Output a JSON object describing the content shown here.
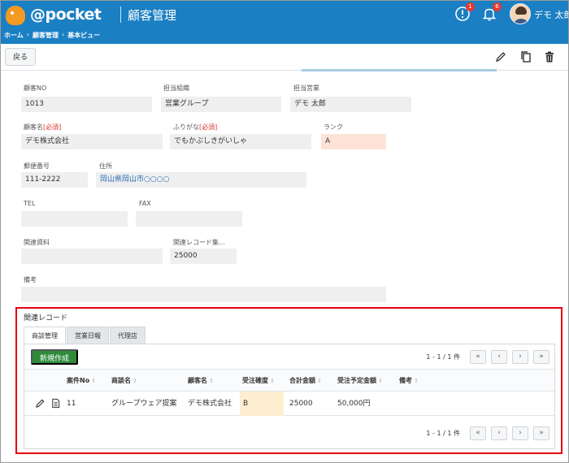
{
  "header": {
    "brand": "@pocket",
    "page_title": "顧客管理",
    "breadcrumb": [
      "ホーム",
      "顧客管理",
      "基本ビュー"
    ],
    "alerts_count": "1",
    "notifications_count": "6",
    "user_name": "デモ 太郎"
  },
  "toolbar": {
    "back_label": "戻る",
    "icons": [
      "edit-icon",
      "copy-icon",
      "trash-icon"
    ]
  },
  "form": {
    "customer_no": {
      "label": "顧客NO",
      "value": "1013"
    },
    "department": {
      "label": "担当組織",
      "value": "営業グループ"
    },
    "sales_rep": {
      "label": "担当営業",
      "value": "デモ 太郎"
    },
    "customer_name": {
      "label": "顧客名",
      "required": "[必須]",
      "value": "デモ株式会社"
    },
    "furigana": {
      "label": "ふりがな",
      "required": "[必須]",
      "value": "でもかぶしきがいしゃ"
    },
    "rank": {
      "label": "ランク",
      "value": "A"
    },
    "postal_code": {
      "label": "郵便番号",
      "value": "111-2222"
    },
    "address": {
      "label": "住所",
      "value": "岡山県岡山市○○○○"
    },
    "tel": {
      "label": "TEL",
      "value": ""
    },
    "fax": {
      "label": "FAX",
      "value": ""
    },
    "related_docs": {
      "label": "関連資料",
      "value": ""
    },
    "related_total": {
      "label": "関連レコード集…",
      "value": "25000"
    },
    "notes": {
      "label": "備考",
      "value": ""
    }
  },
  "related": {
    "title": "関連レコード",
    "tabs": [
      "商談管理",
      "営業日報",
      "代理店"
    ],
    "active_tab": "商談管理",
    "new_button": "新規作成",
    "pager_text": "1 - 1 / 1 件",
    "pager_buttons": [
      "«",
      "‹",
      "›",
      "»"
    ],
    "columns": [
      "案件No",
      "商談名",
      "顧客名",
      "受注確度",
      "合計金額",
      "受注予定金額",
      "備考"
    ],
    "rows": [
      {
        "case_no": "11",
        "deal_name": "グループウェア提案",
        "customer": "デモ株式会社",
        "probability": "B",
        "total": "25000",
        "planned": "50,000円",
        "notes": ""
      }
    ],
    "accent_colors": {
      "new_button": "#2f8a3c",
      "highlight_border": "#e60012",
      "probability_fill": "#fdeed0",
      "header_blue": "#1b7fc3"
    }
  }
}
